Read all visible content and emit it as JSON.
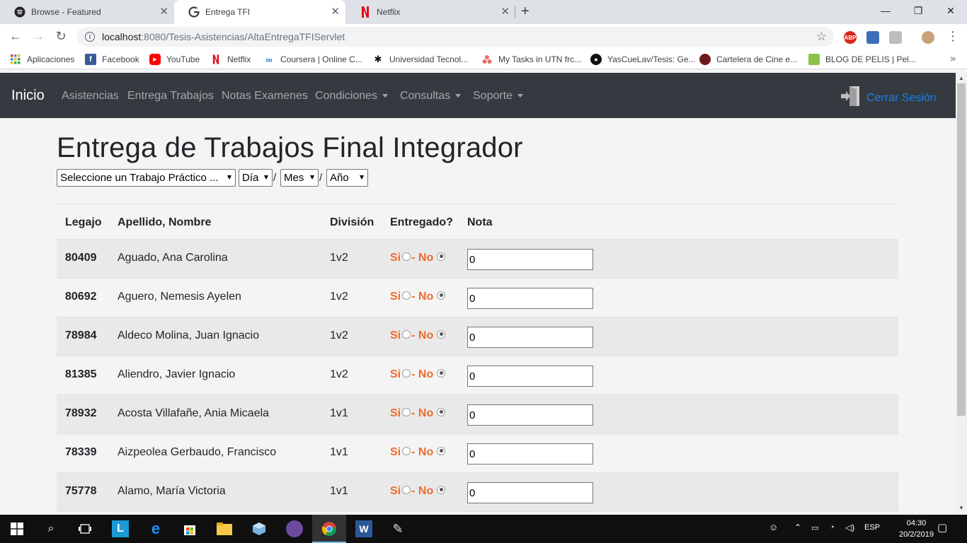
{
  "browser": {
    "tabs": [
      {
        "title": "Browse - Featured",
        "icon": "spotify-icon"
      },
      {
        "title": "Entrega TFI",
        "icon": "chrome-g-icon",
        "active": true
      },
      {
        "title": "Netflix",
        "icon": "netflix-icon"
      }
    ],
    "url_host": "localhost",
    "url_rest": ":8080/Tesis-Asistencias/AltaEntregaTFIServlet",
    "extensions": [
      "ABP"
    ],
    "bookmarks": [
      {
        "label": "Aplicaciones",
        "icon": "apps-grid-icon"
      },
      {
        "label": "Facebook",
        "icon": "facebook-icon"
      },
      {
        "label": "YouTube",
        "icon": "youtube-icon"
      },
      {
        "label": "Netflix",
        "icon": "netflix-icon"
      },
      {
        "label": "Coursera | Online C...",
        "icon": "coursera-icon"
      },
      {
        "label": "Universidad Tecnol...",
        "icon": "utn-icon"
      },
      {
        "label": "My Tasks in UTN frc...",
        "icon": "asana-icon"
      },
      {
        "label": "YasCueLav/Tesis: Ge...",
        "icon": "github-icon"
      },
      {
        "label": "Cartelera de Cine e...",
        "icon": "cinema-icon"
      },
      {
        "label": "BLOG DE PELIS | Pel...",
        "icon": "blog-icon"
      }
    ]
  },
  "navbar": {
    "brand": "Inicio",
    "links": [
      {
        "label": "Asistencias",
        "dropdown": false
      },
      {
        "label": "Entrega Trabajos",
        "dropdown": false
      },
      {
        "label": "Notas Examenes",
        "dropdown": false
      },
      {
        "label": "Condiciones",
        "dropdown": true
      },
      {
        "label": "Consultas",
        "dropdown": true
      },
      {
        "label": "Soporte",
        "dropdown": true
      }
    ],
    "logout": "Cerrar Sesión"
  },
  "page": {
    "title": "Entrega de Trabajos Final Integrador",
    "selects": {
      "trabajo": "Seleccione un Trabajo Práctico ...",
      "dia": "Día",
      "mes": "Mes",
      "anio": "Año"
    },
    "date_separator": "/"
  },
  "table": {
    "headers": {
      "legajo": "Legajo",
      "nombre": "Apellido, Nombre",
      "division": "División",
      "entregado": "Entregado?",
      "nota": "Nota"
    },
    "radio_si": "Si",
    "radio_no": "- No",
    "rows": [
      {
        "legajo": "80409",
        "nombre": "Aguado, Ana Carolina",
        "division": "1v2",
        "entregado": "No",
        "nota": "0"
      },
      {
        "legajo": "80692",
        "nombre": "Aguero, Nemesis Ayelen",
        "division": "1v2",
        "entregado": "No",
        "nota": "0"
      },
      {
        "legajo": "78984",
        "nombre": "Aldeco Molina, Juan Ignacio",
        "division": "1v2",
        "entregado": "No",
        "nota": "0"
      },
      {
        "legajo": "81385",
        "nombre": "Aliendro, Javier Ignacio",
        "division": "1v2",
        "entregado": "No",
        "nota": "0"
      },
      {
        "legajo": "78932",
        "nombre": "Acosta Villafañe, Ania Micaela",
        "division": "1v1",
        "entregado": "No",
        "nota": "0"
      },
      {
        "legajo": "78339",
        "nombre": "Aizpeolea Gerbaudo, Francisco",
        "division": "1v1",
        "entregado": "No",
        "nota": "0"
      },
      {
        "legajo": "75778",
        "nombre": "Alamo, María Victoria",
        "division": "1v1",
        "entregado": "No",
        "nota": "0"
      }
    ]
  },
  "taskbar": {
    "lang": "ESP",
    "time": "04:30",
    "date": "20/2/2019"
  },
  "colors": {
    "navbar_bg": "#343a40",
    "accent_orange": "#ee6b2c",
    "logout_blue": "#1e7ee8",
    "row_stripe": "#e9e9e9"
  }
}
